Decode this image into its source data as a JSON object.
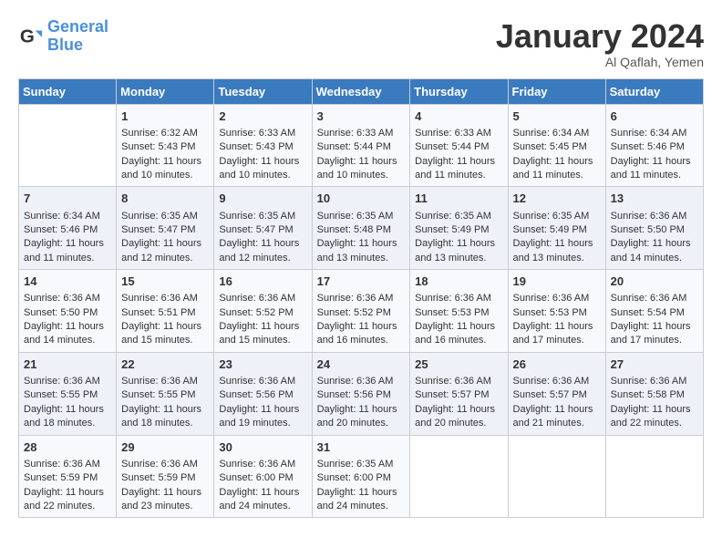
{
  "header": {
    "logo_line1": "General",
    "logo_line2": "Blue",
    "month_title": "January 2024",
    "location": "Al Qaflah, Yemen"
  },
  "columns": [
    "Sunday",
    "Monday",
    "Tuesday",
    "Wednesday",
    "Thursday",
    "Friday",
    "Saturday"
  ],
  "weeks": [
    [
      {
        "day": "",
        "content": ""
      },
      {
        "day": "1",
        "content": "Sunrise: 6:32 AM\nSunset: 5:43 PM\nDaylight: 11 hours\nand 10 minutes."
      },
      {
        "day": "2",
        "content": "Sunrise: 6:33 AM\nSunset: 5:43 PM\nDaylight: 11 hours\nand 10 minutes."
      },
      {
        "day": "3",
        "content": "Sunrise: 6:33 AM\nSunset: 5:44 PM\nDaylight: 11 hours\nand 10 minutes."
      },
      {
        "day": "4",
        "content": "Sunrise: 6:33 AM\nSunset: 5:44 PM\nDaylight: 11 hours\nand 11 minutes."
      },
      {
        "day": "5",
        "content": "Sunrise: 6:34 AM\nSunset: 5:45 PM\nDaylight: 11 hours\nand 11 minutes."
      },
      {
        "day": "6",
        "content": "Sunrise: 6:34 AM\nSunset: 5:46 PM\nDaylight: 11 hours\nand 11 minutes."
      }
    ],
    [
      {
        "day": "7",
        "content": "Sunrise: 6:34 AM\nSunset: 5:46 PM\nDaylight: 11 hours\nand 11 minutes."
      },
      {
        "day": "8",
        "content": "Sunrise: 6:35 AM\nSunset: 5:47 PM\nDaylight: 11 hours\nand 12 minutes."
      },
      {
        "day": "9",
        "content": "Sunrise: 6:35 AM\nSunset: 5:47 PM\nDaylight: 11 hours\nand 12 minutes."
      },
      {
        "day": "10",
        "content": "Sunrise: 6:35 AM\nSunset: 5:48 PM\nDaylight: 11 hours\nand 13 minutes."
      },
      {
        "day": "11",
        "content": "Sunrise: 6:35 AM\nSunset: 5:49 PM\nDaylight: 11 hours\nand 13 minutes."
      },
      {
        "day": "12",
        "content": "Sunrise: 6:35 AM\nSunset: 5:49 PM\nDaylight: 11 hours\nand 13 minutes."
      },
      {
        "day": "13",
        "content": "Sunrise: 6:36 AM\nSunset: 5:50 PM\nDaylight: 11 hours\nand 14 minutes."
      }
    ],
    [
      {
        "day": "14",
        "content": "Sunrise: 6:36 AM\nSunset: 5:50 PM\nDaylight: 11 hours\nand 14 minutes."
      },
      {
        "day": "15",
        "content": "Sunrise: 6:36 AM\nSunset: 5:51 PM\nDaylight: 11 hours\nand 15 minutes."
      },
      {
        "day": "16",
        "content": "Sunrise: 6:36 AM\nSunset: 5:52 PM\nDaylight: 11 hours\nand 15 minutes."
      },
      {
        "day": "17",
        "content": "Sunrise: 6:36 AM\nSunset: 5:52 PM\nDaylight: 11 hours\nand 16 minutes."
      },
      {
        "day": "18",
        "content": "Sunrise: 6:36 AM\nSunset: 5:53 PM\nDaylight: 11 hours\nand 16 minutes."
      },
      {
        "day": "19",
        "content": "Sunrise: 6:36 AM\nSunset: 5:53 PM\nDaylight: 11 hours\nand 17 minutes."
      },
      {
        "day": "20",
        "content": "Sunrise: 6:36 AM\nSunset: 5:54 PM\nDaylight: 11 hours\nand 17 minutes."
      }
    ],
    [
      {
        "day": "21",
        "content": "Sunrise: 6:36 AM\nSunset: 5:55 PM\nDaylight: 11 hours\nand 18 minutes."
      },
      {
        "day": "22",
        "content": "Sunrise: 6:36 AM\nSunset: 5:55 PM\nDaylight: 11 hours\nand 18 minutes."
      },
      {
        "day": "23",
        "content": "Sunrise: 6:36 AM\nSunset: 5:56 PM\nDaylight: 11 hours\nand 19 minutes."
      },
      {
        "day": "24",
        "content": "Sunrise: 6:36 AM\nSunset: 5:56 PM\nDaylight: 11 hours\nand 20 minutes."
      },
      {
        "day": "25",
        "content": "Sunrise: 6:36 AM\nSunset: 5:57 PM\nDaylight: 11 hours\nand 20 minutes."
      },
      {
        "day": "26",
        "content": "Sunrise: 6:36 AM\nSunset: 5:57 PM\nDaylight: 11 hours\nand 21 minutes."
      },
      {
        "day": "27",
        "content": "Sunrise: 6:36 AM\nSunset: 5:58 PM\nDaylight: 11 hours\nand 22 minutes."
      }
    ],
    [
      {
        "day": "28",
        "content": "Sunrise: 6:36 AM\nSunset: 5:59 PM\nDaylight: 11 hours\nand 22 minutes."
      },
      {
        "day": "29",
        "content": "Sunrise: 6:36 AM\nSunset: 5:59 PM\nDaylight: 11 hours\nand 23 minutes."
      },
      {
        "day": "30",
        "content": "Sunrise: 6:36 AM\nSunset: 6:00 PM\nDaylight: 11 hours\nand 24 minutes."
      },
      {
        "day": "31",
        "content": "Sunrise: 6:35 AM\nSunset: 6:00 PM\nDaylight: 11 hours\nand 24 minutes."
      },
      {
        "day": "",
        "content": ""
      },
      {
        "day": "",
        "content": ""
      },
      {
        "day": "",
        "content": ""
      }
    ]
  ]
}
